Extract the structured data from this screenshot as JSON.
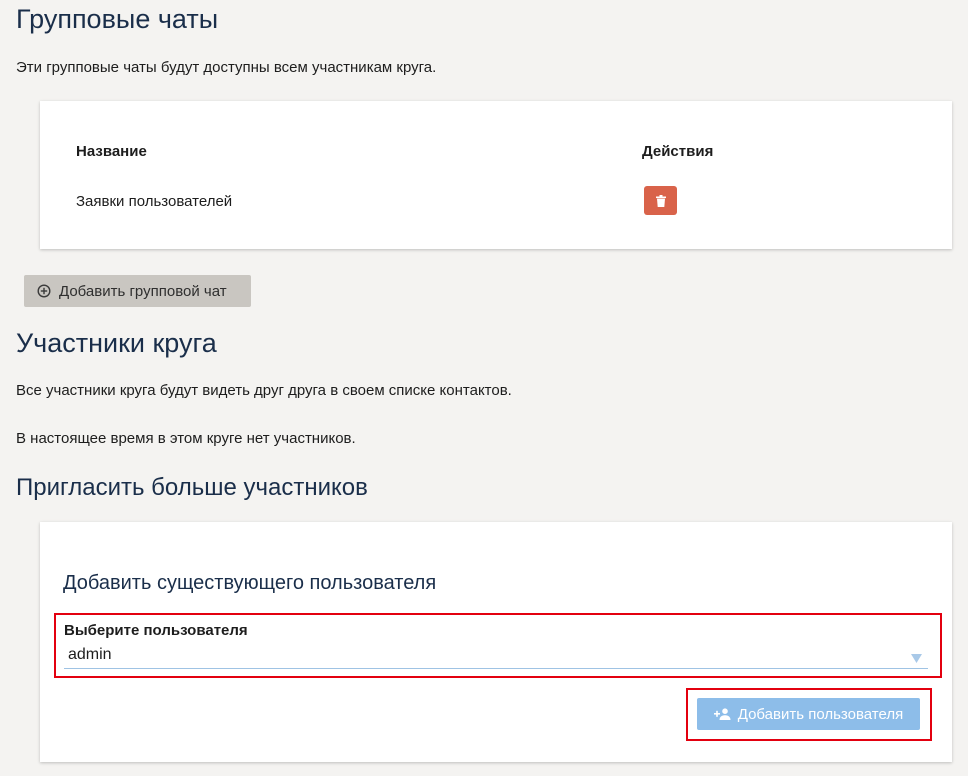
{
  "group_chats": {
    "title": "Групповые чаты",
    "description": "Эти групповые чаты будут доступны всем участникам круга.",
    "table": {
      "headers": [
        "Название",
        "Действия"
      ],
      "rows": [
        {
          "name": "Заявки пользователей",
          "action_icon": "trash-icon"
        }
      ]
    },
    "add_button_label": "Добавить групповой чат"
  },
  "members": {
    "title": "Участники круга",
    "description": "Все участники круга будут видеть друг друга в своем списке контактов.",
    "status": "В настоящее время в этом круге нет участников."
  },
  "invite": {
    "title": "Пригласить больше участников",
    "card_title": "Добавить существующего пользователя",
    "select_label": "Выберите пользователя",
    "select_value": "admin",
    "add_button_label": "Добавить пользователя"
  },
  "colors": {
    "heading": "#1a2e4a",
    "delete_button": "#d9634a",
    "primary_button": "#8dbde9",
    "secondary_button": "#c9c6c1",
    "highlight": "#e3000f"
  }
}
